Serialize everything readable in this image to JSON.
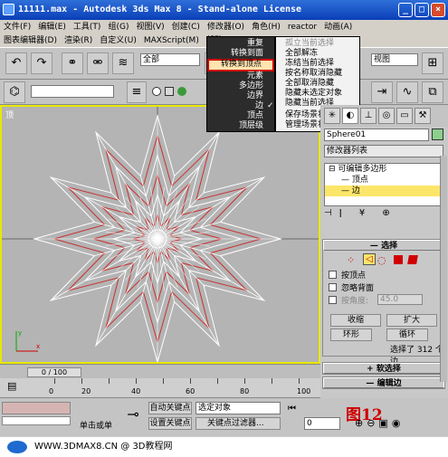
{
  "window": {
    "title": "11111.max - Autodesk 3ds Max 8  - Stand-alone License",
    "minimize": "_",
    "maximize": "□",
    "close": "×"
  },
  "menu_row1": [
    "文件(F)",
    "编辑(E)",
    "工具(T)",
    "组(G)",
    "视图(V)",
    "创建(C)",
    "修改器(O)",
    "角色(H)",
    "reactor",
    "动画(A)"
  ],
  "menu_row2": [
    "图表编辑器(D)",
    "渲染(R)",
    "自定义(U)",
    "MAXScript(M)",
    "帮助"
  ],
  "toolbar": {
    "selection_filter": "全部",
    "ref_coord": "视图"
  },
  "viewport": {
    "label": "顶",
    "accent": "#e8e800",
    "star_color": "#ffffff",
    "edge_color": "#c83030"
  },
  "context_menu_left": {
    "items": [
      {
        "label": "重复",
        "highlight": false
      },
      {
        "label": "转换到面",
        "highlight": false
      },
      {
        "label": "转换到顶点",
        "highlight": true
      },
      {
        "label": "元素",
        "highlight": false
      },
      {
        "label": "多边形",
        "highlight": false
      },
      {
        "label": "边界",
        "highlight": false
      },
      {
        "label": "边",
        "highlight": false,
        "checked": true
      },
      {
        "label": "顶点",
        "highlight": false
      },
      {
        "label": "顶层级",
        "highlight": false
      }
    ]
  },
  "context_menu_right": {
    "items": [
      {
        "label": "孤立当前选择",
        "disabled": true
      },
      {
        "label": "全部解冻",
        "disabled": false
      },
      {
        "label": "冻结当前选择",
        "disabled": false
      },
      {
        "label": "按名称取消隐藏",
        "disabled": false
      },
      {
        "label": "全部取消隐藏",
        "disabled": false
      },
      {
        "label": "隐藏未选定对象",
        "disabled": false
      },
      {
        "label": "隐藏当前选择",
        "disabled": false
      },
      {
        "label": "保存场景状态...",
        "disabled": false
      },
      {
        "label": "管理场景状态...",
        "disabled": false
      }
    ]
  },
  "command_panel": {
    "object_name": "Sphere01",
    "object_color": "#8cd08c",
    "modifier_list": "修改器列表",
    "stack": [
      {
        "label": "可编辑多边形",
        "selected": false
      },
      {
        "label": "顶点",
        "selected": false
      },
      {
        "label": "边",
        "selected": true
      }
    ],
    "selection_rollout": {
      "title": "选择",
      "by_vertex": "按顶点",
      "ignore_backfacing": "忽略背面",
      "by_angle": "按角度:",
      "angle_value": "45.0",
      "shrink": "收缩",
      "grow": "扩大",
      "ring": "环形",
      "loop": "循环",
      "status": "选择了 312 个边"
    },
    "soft_selection": "软选择",
    "edit_edges": "编辑边"
  },
  "timeline": {
    "frame": "0 / 100",
    "ticks": [
      "0",
      "20",
      "40",
      "60",
      "80",
      "100"
    ]
  },
  "status": {
    "auto_key": "自动关键点",
    "selected_object": "选定对象",
    "set_key": "设置关键点",
    "key_filter": "关键点过滤器...",
    "click_hint": "单击或单",
    "frame_input": "0",
    "watermark": "图12"
  },
  "footer": {
    "text": "WWW.3DMAX8.CN @ 3D教程网"
  }
}
